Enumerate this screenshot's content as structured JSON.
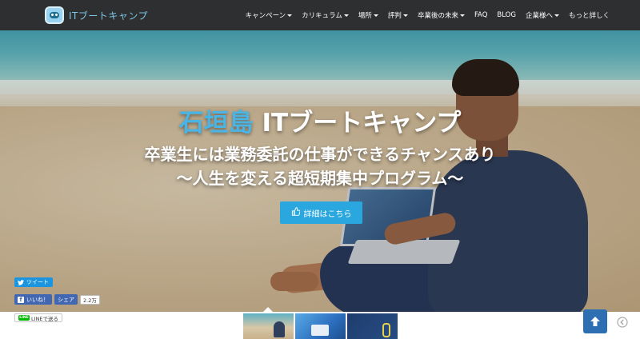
{
  "brand": {
    "name": "ITブートキャンプ",
    "logo_icon": "robot-logo-icon"
  },
  "nav": {
    "items": [
      {
        "label": "キャンペーン",
        "dropdown": true
      },
      {
        "label": "カリキュラム",
        "dropdown": true
      },
      {
        "label": "場所",
        "dropdown": true
      },
      {
        "label": "評判",
        "dropdown": true
      },
      {
        "label": "卒業後の未来",
        "dropdown": true
      },
      {
        "label": "FAQ",
        "dropdown": false
      },
      {
        "label": "BLOG",
        "dropdown": false
      },
      {
        "label": "企業様へ",
        "dropdown": true
      },
      {
        "label": "もっと詳しく",
        "dropdown": false
      }
    ]
  },
  "hero": {
    "title_accent": "石垣島",
    "title_rest": " ITブートキャンプ",
    "subtitle_line1": "卒業生には業務委託の仕事ができるチャンスあり",
    "subtitle_line2": "〜人生を変える超短期集中プログラム〜",
    "cta_label": "詳細はこちら",
    "cta_icon": "thumbs-up-icon"
  },
  "social": {
    "tweet_label": "ツイート",
    "fb_like_label": "いいね！",
    "fb_share_label": "シェア",
    "fb_count": "2.2万",
    "line_label": "LINEで送る",
    "line_logo_text": "LINE"
  },
  "colors": {
    "topbar": "#2e2f31",
    "accent_blue": "#2aa7df",
    "title_accent": "#4ab4e4",
    "twitter": "#1b95e0",
    "facebook": "#4267b2",
    "line": "#00b900",
    "scroll_top": "#2e6fb4"
  },
  "thumbnails": [
    "beach-slide-thumb",
    "blue-sky-slide-thumb",
    "dark-blue-slide-thumb"
  ],
  "scroll_top_icon": "arrow-up-icon",
  "edge_icon": "chevron-left-icon"
}
